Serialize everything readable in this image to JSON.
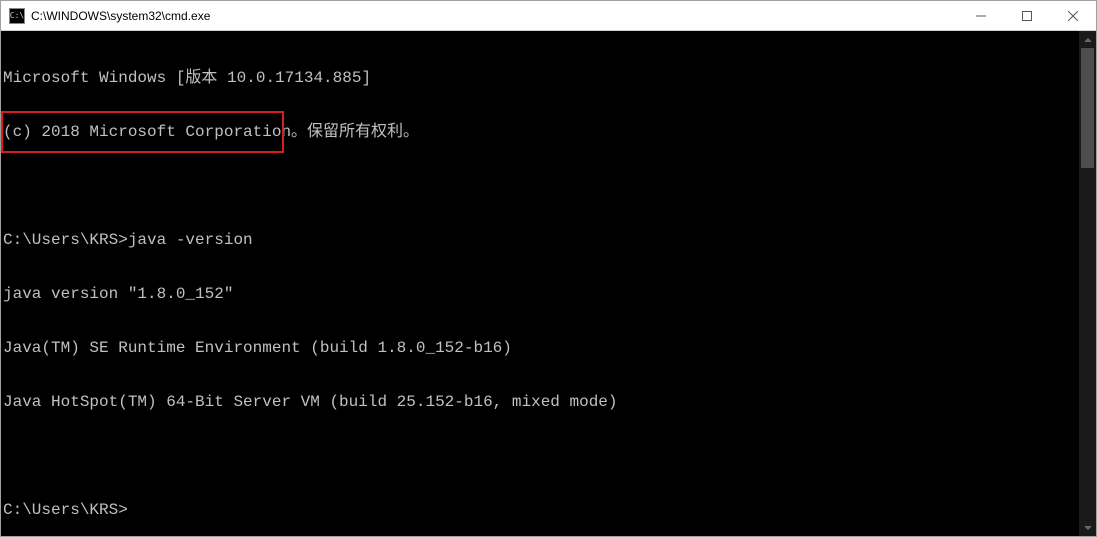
{
  "window": {
    "icon_text": "C:\\",
    "title": "C:\\WINDOWS\\system32\\cmd.exe"
  },
  "terminal": {
    "lines": [
      "Microsoft Windows [版本 10.0.17134.885]",
      "(c) 2018 Microsoft Corporation。保留所有权利。",
      "",
      "C:\\Users\\KRS>java -version",
      "java version \"1.8.0_152\"",
      "Java(TM) SE Runtime Environment (build 1.8.0_152-b16)",
      "Java HotSpot(TM) 64-Bit Server VM (build 25.152-b16, mixed mode)",
      "",
      "C:\\Users\\KRS>"
    ]
  },
  "highlight": {
    "description": "red-box-around-java-version-command-and-output"
  }
}
